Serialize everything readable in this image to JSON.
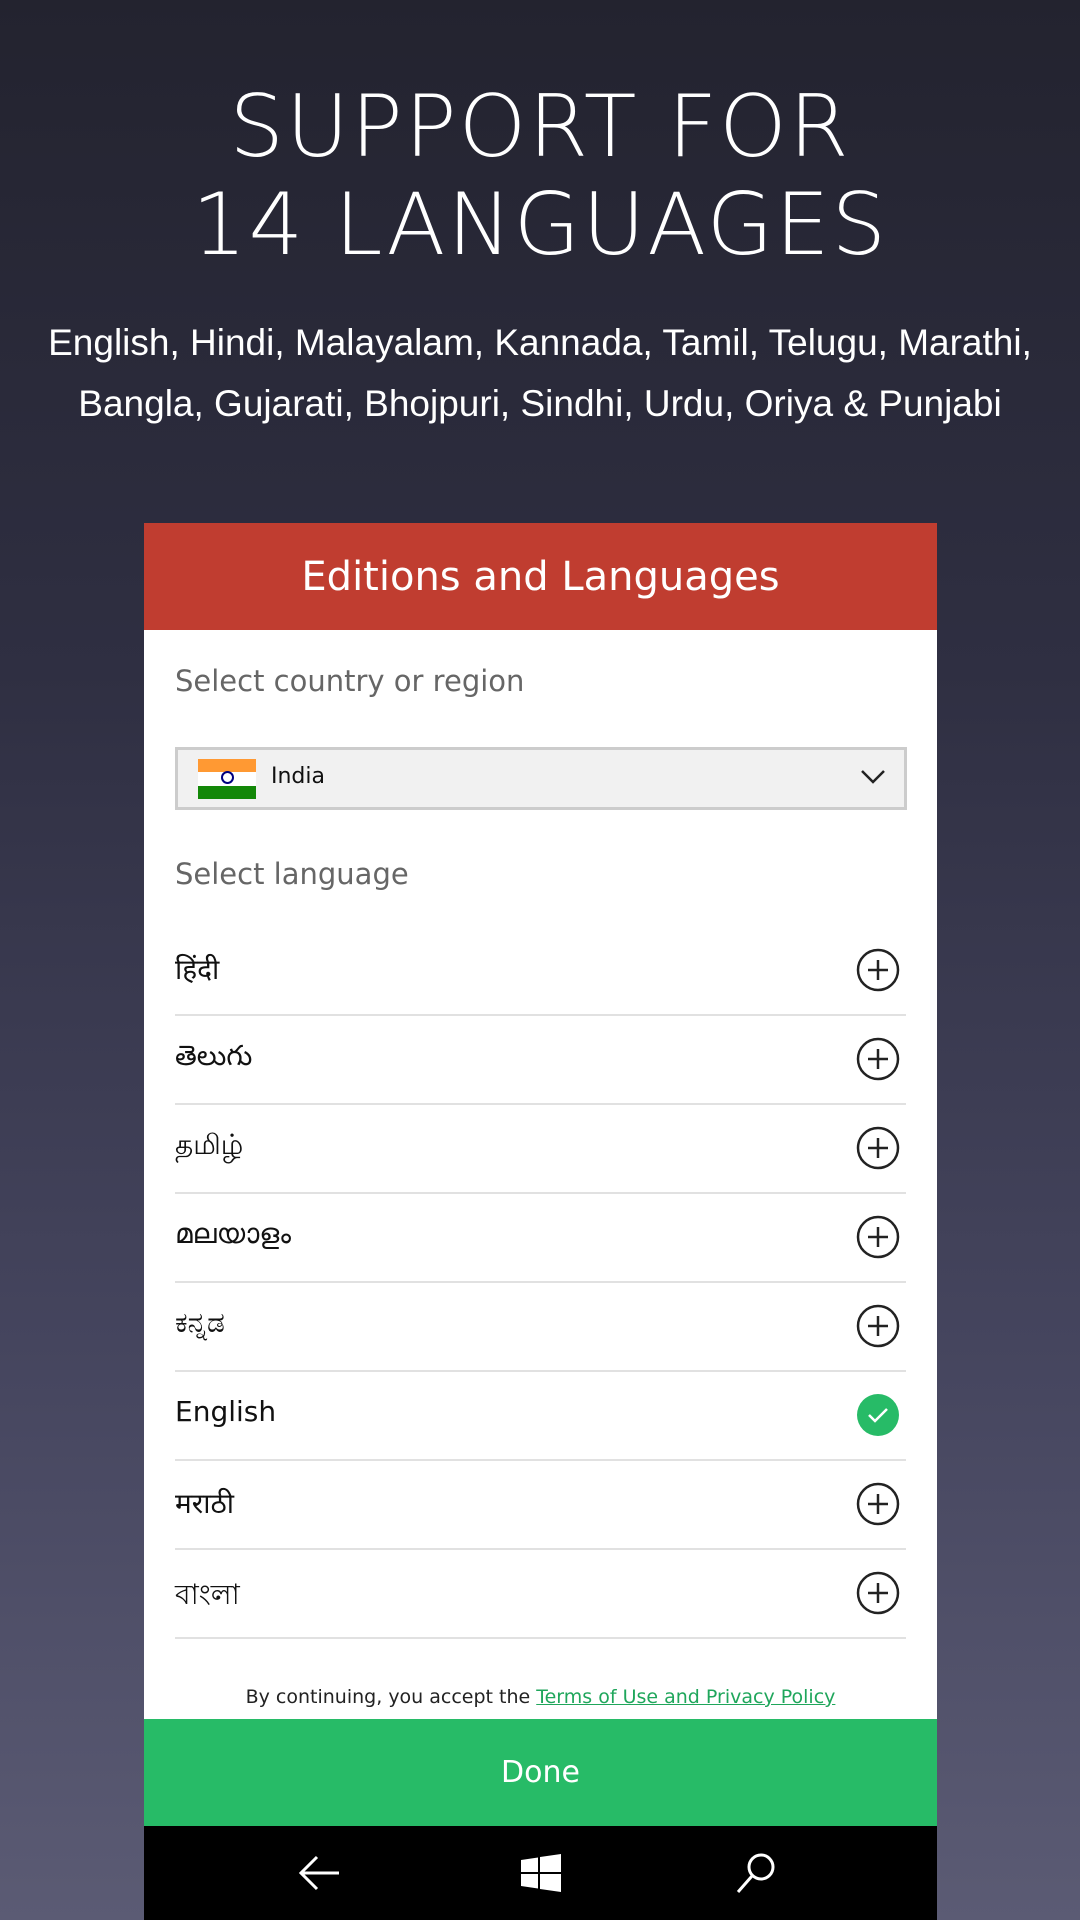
{
  "promo": {
    "headline_line1": "SUPPORT FOR",
    "headline_line2": "14 LANGUAGES",
    "languages_line1": "English, Hindi, Malayalam, Kannada, Tamil, Telugu, Marathi,",
    "languages_line2": "Bangla, Gujarati, Bhojpuri, Sindhi, Urdu, Oriya & Punjabi"
  },
  "dialog": {
    "title": "Editions and Languages",
    "country_label": "Select country or region",
    "country_value": "India",
    "language_label": "Select language",
    "languages": [
      {
        "label": "हिंदी",
        "state": "add"
      },
      {
        "label": "తెలుగు",
        "state": "add"
      },
      {
        "label": "தமிழ்",
        "state": "add"
      },
      {
        "label": "മലയാളം",
        "state": "add"
      },
      {
        "label": "ಕನ್ನಡ",
        "state": "add"
      },
      {
        "label": "English",
        "state": "selected"
      },
      {
        "label": "मराठी",
        "state": "add"
      },
      {
        "label": "বাংলা",
        "state": "add"
      }
    ],
    "terms_prefix": "By continuing, you accept the",
    "terms_link": "Terms of Use and Privacy Policy",
    "done_label": "Done"
  },
  "colors": {
    "header": "#c03d30",
    "done": "#27bb67",
    "selected_check": "#27bb67"
  },
  "navbar": {
    "icons": [
      "back-arrow-icon",
      "windows-logo-icon",
      "search-icon"
    ]
  }
}
